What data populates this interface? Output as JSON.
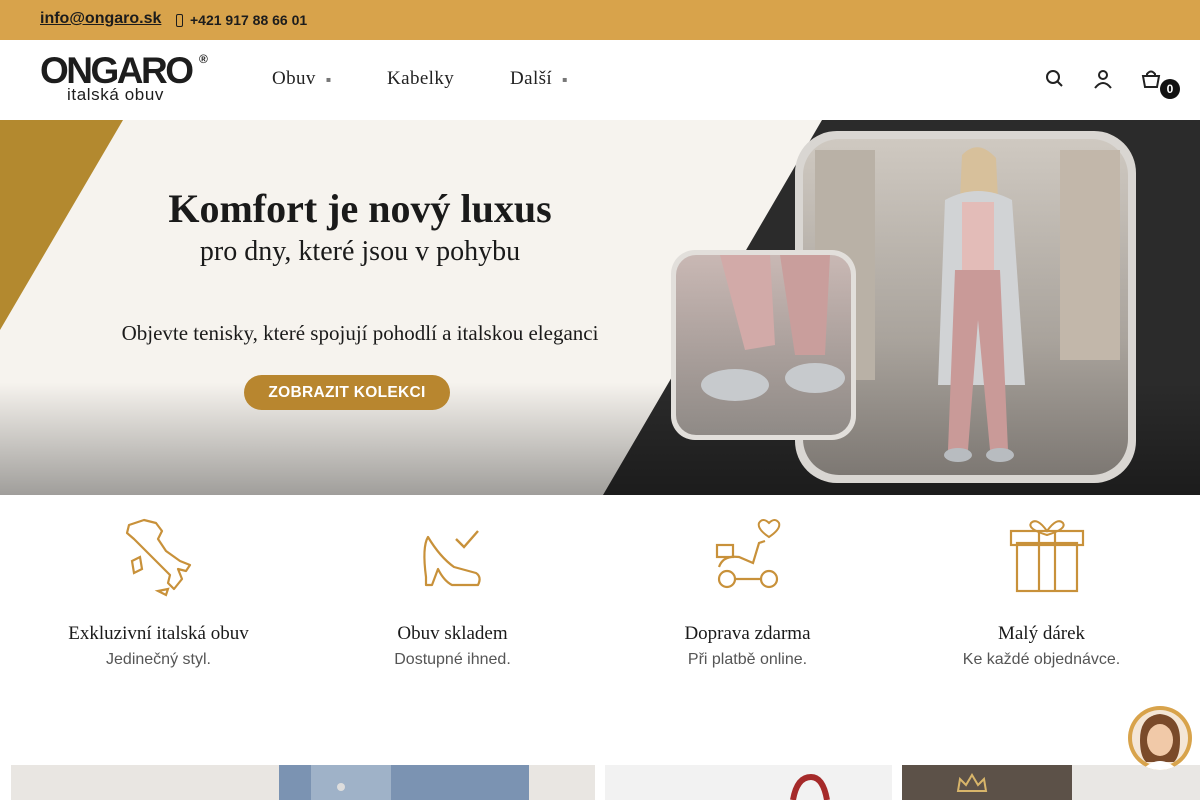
{
  "topbar": {
    "email": "info@ongaro.sk",
    "phone": "+421 917 88 66 01",
    "phone_icon": "phone-icon"
  },
  "header": {
    "logo": {
      "brand": "ONGARO",
      "reg": "®",
      "tagline": "italská obuv"
    },
    "nav": [
      {
        "label": "Obuv",
        "dropdown": true
      },
      {
        "label": "Kabelky",
        "dropdown": false
      },
      {
        "label": "Další",
        "dropdown": true
      }
    ],
    "icons": [
      "search-icon",
      "user-icon",
      "cart-icon"
    ],
    "cart_count": "0"
  },
  "hero": {
    "title": "Komfort je nový luxus",
    "subtitle": "pro dny, které jsou v pohybu",
    "description": "Objevte tenisky, které spojují pohodlí a italskou eleganci",
    "button": "ZOBRAZIT KOLEKCI"
  },
  "features": [
    {
      "icon": "italy-map-icon",
      "title": "Exkluzivní italská obuv",
      "subtitle": "Jedinečný styl."
    },
    {
      "icon": "shoe-check-icon",
      "title": "Obuv skladem",
      "subtitle": "Dostupné ihned."
    },
    {
      "icon": "scooter-icon",
      "title": "Doprava zdarma",
      "subtitle": "Při platbě online."
    },
    {
      "icon": "gift-icon",
      "title": "Malý dárek",
      "subtitle": "Ke každé objednávce."
    }
  ],
  "colors": {
    "accent": "#d8a34b",
    "button": "#b8862f",
    "icon": "#c8913a",
    "dark": "#1d1d1d"
  }
}
